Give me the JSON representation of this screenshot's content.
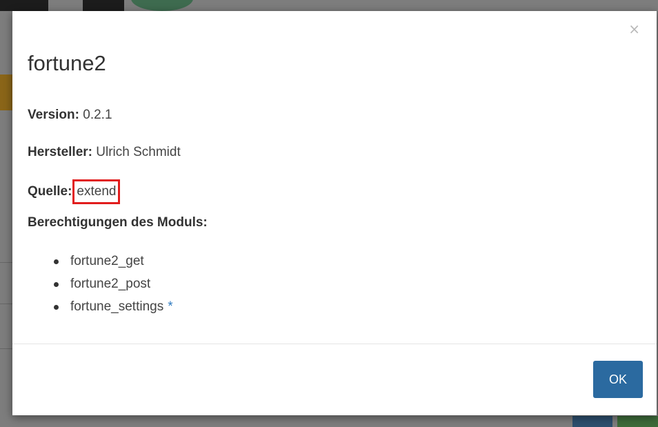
{
  "modal": {
    "title": "fortune2",
    "close_symbol": "×",
    "version_label": "Version:",
    "version_value": "0.2.1",
    "vendor_label": "Hersteller:",
    "vendor_value": "Ulrich Schmidt",
    "source_label": "Quelle:",
    "source_value": "extend",
    "permissions_heading": "Berechtigungen des Moduls:",
    "permissions": [
      {
        "name": "fortune2_get",
        "mark": ""
      },
      {
        "name": "fortune2_post",
        "mark": ""
      },
      {
        "name": "fortune_settings",
        "mark": "*"
      }
    ],
    "ok_label": "OK"
  },
  "colors": {
    "highlight_border": "#e11d1d",
    "ok_button": "#2b6aa0",
    "asterisk": "#2f7bc0",
    "overlay": "#7d7d7d"
  },
  "icons": {
    "close": "close-icon",
    "bullet": "bullet-dot"
  }
}
